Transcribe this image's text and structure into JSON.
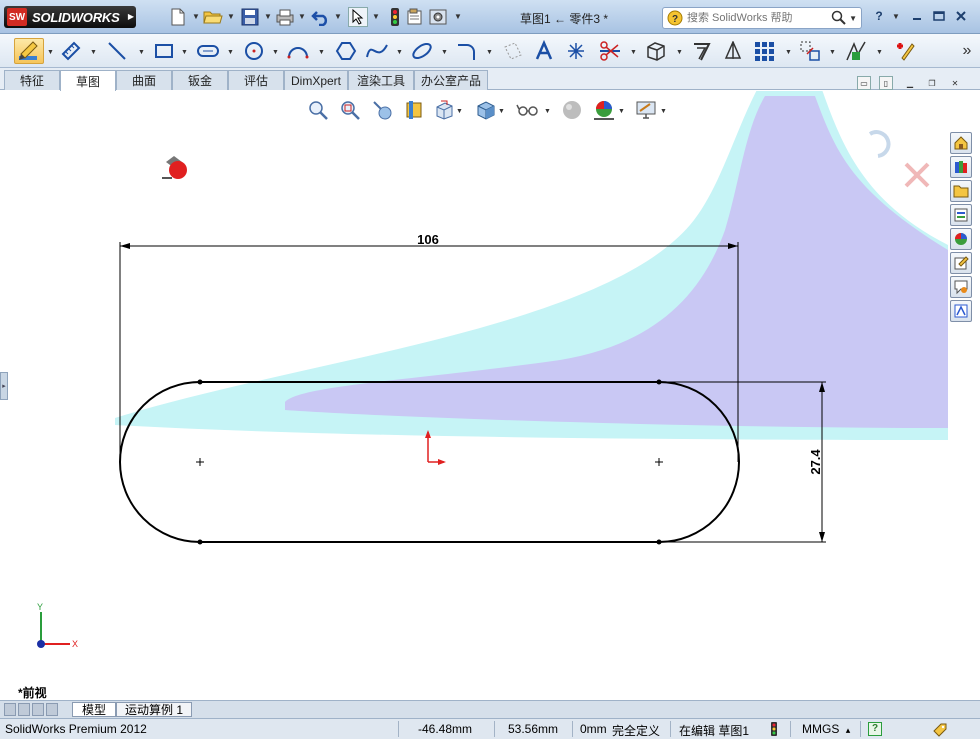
{
  "app": {
    "logo_mark": "SW",
    "logo_text": "SOLIDWORKS",
    "document_title": "草图1 ← 零件3 *",
    "search_placeholder": "搜索 SolidWorks 帮助",
    "help_symbol": "?"
  },
  "tabs": [
    {
      "label": "特征"
    },
    {
      "label": "草图"
    },
    {
      "label": "曲面"
    },
    {
      "label": "钣金"
    },
    {
      "label": "评估"
    },
    {
      "label": "DimXpert"
    },
    {
      "label": "渲染工具"
    },
    {
      "label": "办公室产品"
    }
  ],
  "viewport": {
    "dimension_width": "106",
    "dimension_height": "27.4",
    "view_name": "*前视",
    "triad_x": "X",
    "triad_y": "Y"
  },
  "model_tabs": [
    {
      "label": "模型"
    },
    {
      "label": "运动算例 1"
    }
  ],
  "status": {
    "product": "SolidWorks Premium 2012",
    "x_coord": "-46.48mm",
    "y_coord": "53.56mm",
    "z_coord": "0mm",
    "definition": "完全定义",
    "editing": "在编辑 草图1",
    "units": "MMGS",
    "units_arrow": "▴",
    "help": "?"
  },
  "colors": {
    "accent": "#f6c55a",
    "sketch_line": "#000000",
    "highlight_purple": "#c9c8f4",
    "highlight_cyan": "#c6f4f6",
    "origin_red": "#e02020"
  },
  "icons": {
    "chevron": "»"
  }
}
